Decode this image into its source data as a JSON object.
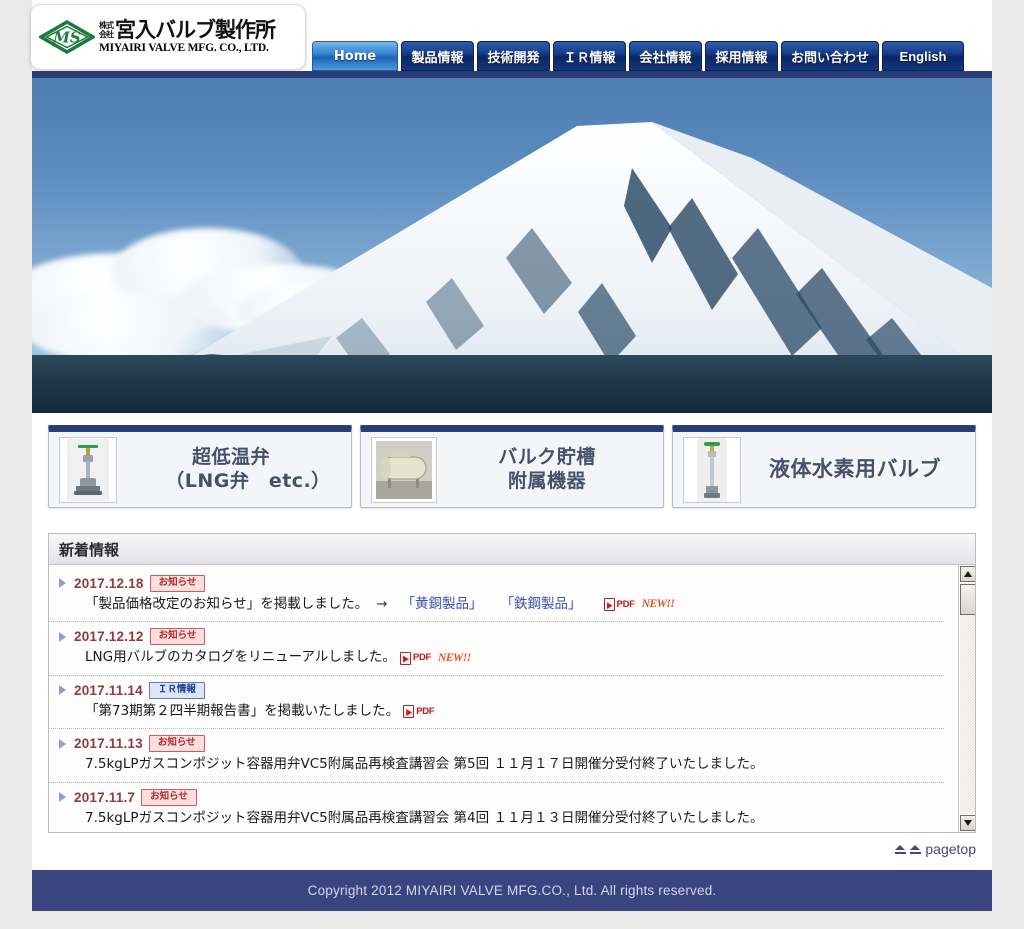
{
  "header": {
    "logo": {
      "icon": "ms-diamond-logo",
      "prefix_line1": "株式",
      "prefix_line2": "会社",
      "name_jp": "宮入バルブ製作所",
      "name_en": "MIYAIRI VALVE MFG. CO., LTD."
    },
    "nav": [
      {
        "label": "Home",
        "active": true
      },
      {
        "label": "製品情報",
        "active": false
      },
      {
        "label": "技術開発",
        "active": false
      },
      {
        "label": "ＩＲ情報",
        "active": false
      },
      {
        "label": "会社情報",
        "active": false
      },
      {
        "label": "採用情報",
        "active": false
      },
      {
        "label": "お問い合わせ",
        "active": false
      },
      {
        "label": "English",
        "active": false
      }
    ]
  },
  "hero": {
    "alt": "mount-fuji-photo"
  },
  "banners": [
    {
      "icon": "cryogenic-valve-thumb",
      "line1": "超低温弁",
      "line2": "（LNG弁　etc.）"
    },
    {
      "icon": "bulk-storage-tank-thumb",
      "line1": "バルク貯槽",
      "line2": "附属機器"
    },
    {
      "icon": "liquid-hydrogen-valve-thumb",
      "line1": "液体水素用バルブ",
      "line2": ""
    }
  ],
  "news": {
    "title": "新着情報",
    "items": [
      {
        "date": "2017.12.18",
        "badge": "お知らせ",
        "badge_type": "notice",
        "text": "「製品価格改定のお知らせ」を掲載しました。",
        "arrow": "→",
        "link1": "「黄銅製品」",
        "link2": "「鉄鋼製品」",
        "pdf": "PDF",
        "new": "NEW!!"
      },
      {
        "date": "2017.12.12",
        "badge": "お知らせ",
        "badge_type": "notice",
        "text": "LNG用バルブのカタログをリニューアルしました。",
        "pdf": "PDF",
        "new": "NEW!!"
      },
      {
        "date": "2017.11.14",
        "badge": "ＩＲ情報",
        "badge_type": "ir",
        "text": "「第73期第２四半期報告書」を掲載いたしました。",
        "pdf": "PDF"
      },
      {
        "date": "2017.11.13",
        "badge": "お知らせ",
        "badge_type": "notice",
        "text": "7.5kgLPガスコンポジット容器用弁VC5附属品再検査講習会 第5回 １１月１７日開催分受付終了いたしました。"
      },
      {
        "date": "2017.11.7",
        "badge": "お知らせ",
        "badge_type": "notice",
        "text": "7.5kgLPガスコンポジット容器用弁VC5附属品再検査講習会 第4回 １１月１３日開催分受付終了いたしました。"
      }
    ],
    "scrollbar": {
      "up_icon": "scroll-up-arrow-icon",
      "down_icon": "scroll-down-arrow-icon"
    }
  },
  "pagetop": {
    "icon": "pagetop-arrow-icon",
    "label": "pagetop"
  },
  "footer": {
    "copyright": "Copyright 2012 MIYAIRI VALVE MFG.CO., Ltd. All rights reserved."
  },
  "colors": {
    "nav_blue": "#133a87",
    "nav_active_blue": "#2d7fcf",
    "accent_navy": "#2b3d77",
    "footer_navy": "#3a4580",
    "notice_red": "#b02b2b",
    "ir_blue": "#1d3f8f",
    "new_orange": "#ef4d10",
    "page_bg": "#eaeaea"
  }
}
